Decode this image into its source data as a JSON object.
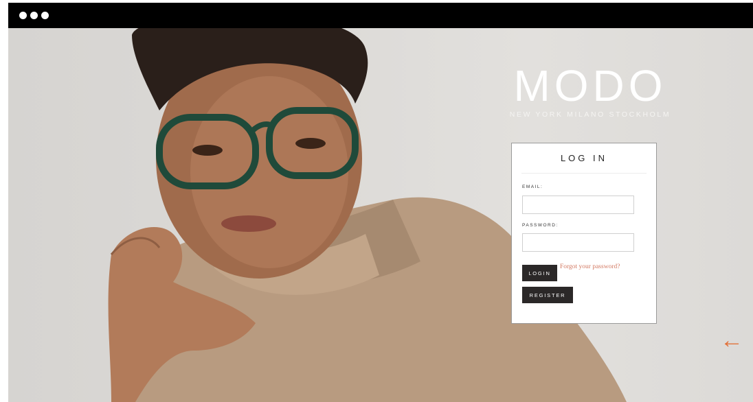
{
  "brand": {
    "name": "MODO",
    "tagline": "NEW YORK  MILANO  STOCKHOLM"
  },
  "login": {
    "title": "LOG IN",
    "email_label": "EMAIL:",
    "email_value": "",
    "password_label": "PASSWORD:",
    "password_value": "",
    "login_label": "LOGIN",
    "forgot_label": "Forgot your password?",
    "register_label": "REGISTER"
  },
  "annotation": {
    "arrow": "←"
  },
  "colors": {
    "titlebar": "#000000",
    "button": "#2b2828",
    "forgot_link": "#d37a63",
    "arrow": "#e2713a"
  },
  "icons": [
    "window-dot-icon",
    "arrow-left-icon"
  ]
}
